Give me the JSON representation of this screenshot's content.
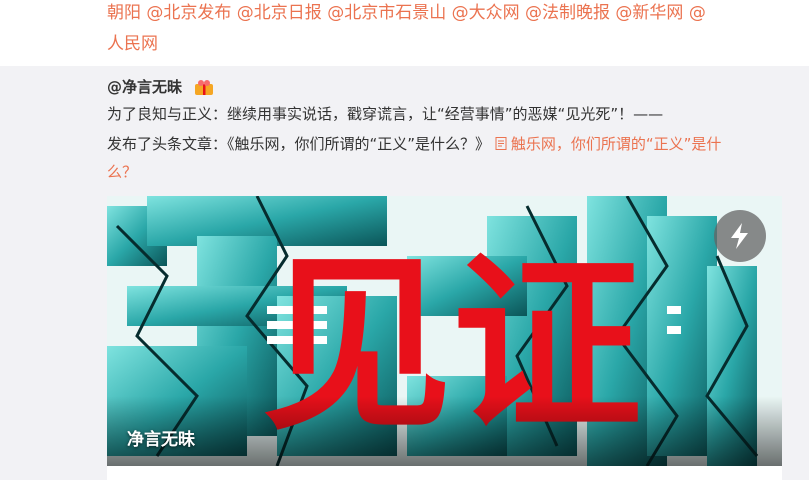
{
  "header": {
    "mentions_line1": "朝阳 @北京发布 @北京日报 @北京市石景山 @大众网 @法制晚报 @新华网 @",
    "mentions_line2": "人民网"
  },
  "post": {
    "author": "@净言无昧",
    "badge_icon": "gift-badge-icon",
    "text_line1": "为了良知与正义：继续用事实说话，戳穿谎言，让“经营事情”的恶媒“见光死”！——",
    "text_line2_prefix": "发布了头条文章：《触乐网，你们所谓的“正义”是什么？》",
    "article_link_line2": "触乐网，你们所谓的“正义”是什",
    "article_link_line3": "么？"
  },
  "image_card": {
    "big_text": "见证",
    "caption": "净言无昧",
    "flash_icon": "lightning-icon"
  },
  "colors": {
    "link": "#eb7350",
    "text": "#333333",
    "background": "#f2f2f5",
    "stamp_red": "#e8101a"
  }
}
